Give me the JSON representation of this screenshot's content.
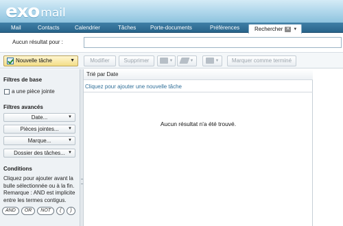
{
  "app": {
    "logo_exo": "exo",
    "logo_mail": "mail"
  },
  "tabs": [
    {
      "label": "Mail"
    },
    {
      "label": "Contacts"
    },
    {
      "label": "Calendrier"
    },
    {
      "label": "Tâches"
    },
    {
      "label": "Porte-documents"
    },
    {
      "label": "Préférences"
    }
  ],
  "active_tab": {
    "label": "Rechercher",
    "close_icon": "close-icon"
  },
  "search": {
    "result_label": "Aucun résultat pour :",
    "value": ""
  },
  "toolbar": {
    "new_task": "Nouvelle tâche",
    "modify": "Modifier",
    "delete": "Supprimer",
    "mark_done": "Marquer comme terminé"
  },
  "filters": {
    "basic_title": "Filtres de base",
    "attachment": "a une pièce jointe",
    "advanced_title": "Filtres avancés",
    "date": "Date...",
    "attachments": "Pièces jointes...",
    "mark": "Marque...",
    "folder": "Dossier des tâches...",
    "conditions_title": "Conditions",
    "conditions_text": "Cliquez pour ajouter avant la bulle sélectionnée ou à la fin. Remarque : AND est implicite entre les termes contigus.",
    "ops": [
      "AND",
      "OR",
      "NOT",
      "(",
      ")"
    ]
  },
  "list": {
    "sort_label": "Trié par Date",
    "add_label": "Cliquez pour ajouter une nouvelle tâche",
    "empty_message": "Aucun résultat n'a été trouvé."
  },
  "colors": {
    "accent": "#28648a",
    "header": "#a9d3e9",
    "new_task_bg": "#f3dd86"
  }
}
